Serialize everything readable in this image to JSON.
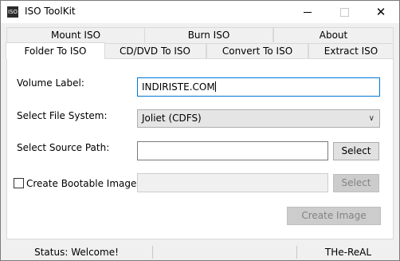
{
  "window": {
    "title": "ISO ToolKit",
    "icon_text": "ISO",
    "icon": "app-icon",
    "min_icon": "minimize-icon",
    "max_icon": "maximize-icon",
    "close_icon": "close-icon",
    "close_glyph": "✕"
  },
  "tabs": {
    "back_row": [
      "Mount ISO",
      "Burn ISO",
      "About"
    ],
    "front_row": [
      "Folder To ISO",
      "CD/DVD To ISO",
      "Convert To ISO",
      "Extract ISO"
    ],
    "active": "Folder To ISO"
  },
  "form": {
    "volume_label": "Volume Label:",
    "volume_value": "INDIRISTE.COM",
    "file_system_label": "Select File System:",
    "file_system_value": "Joliet (CDFS)",
    "chevron": "∨",
    "source_path_label": "Select Source Path:",
    "source_path_value": "",
    "select_button": "Select",
    "bootable_label": "Create Bootable Image",
    "bootable_checked": false,
    "bootable_path_value": "",
    "bootable_select_button": "Select",
    "create_button": "Create Image"
  },
  "status": {
    "text": "Status: Welcome!",
    "middle": "",
    "right": "THe-ReAL"
  }
}
